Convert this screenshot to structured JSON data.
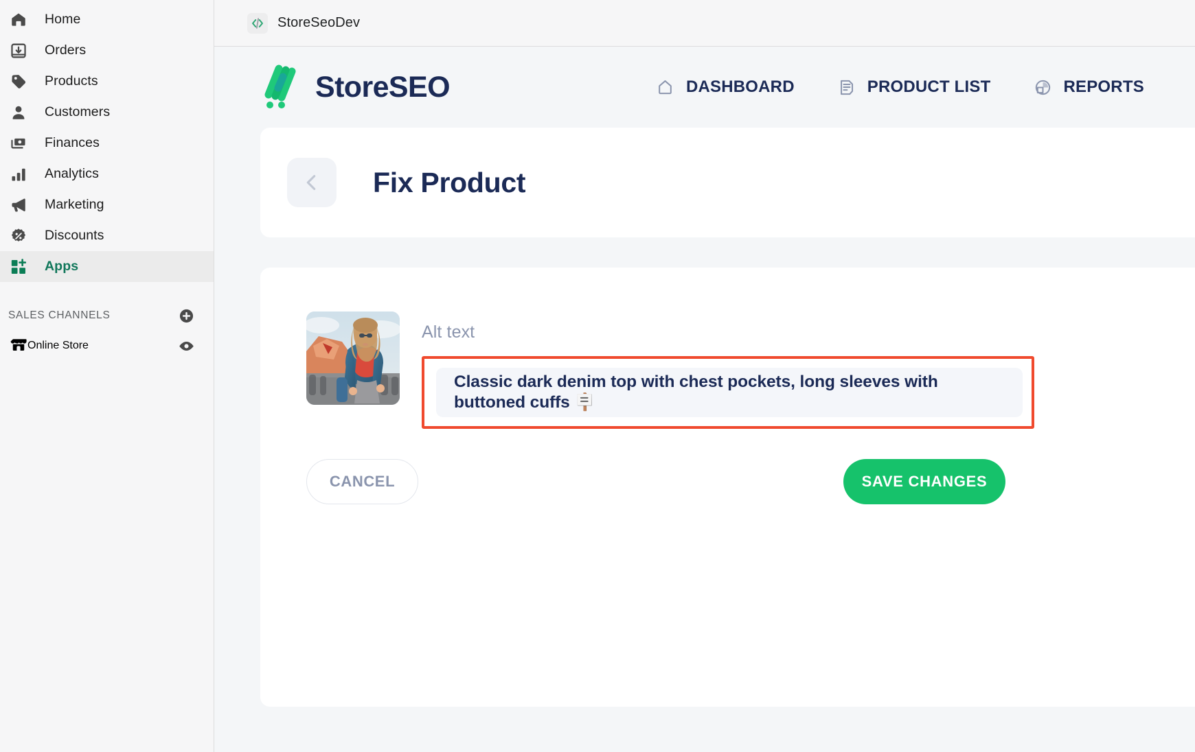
{
  "sidebar": {
    "items": [
      {
        "label": "Home",
        "icon": "home-icon",
        "active": false
      },
      {
        "label": "Orders",
        "icon": "orders-inbox-icon",
        "active": false
      },
      {
        "label": "Products",
        "icon": "product-tag-icon",
        "active": false
      },
      {
        "label": "Customers",
        "icon": "customer-person-icon",
        "active": false
      },
      {
        "label": "Finances",
        "icon": "finances-cash-icon",
        "active": false
      },
      {
        "label": "Analytics",
        "icon": "analytics-bars-icon",
        "active": false
      },
      {
        "label": "Marketing",
        "icon": "marketing-megaphone-icon",
        "active": false
      },
      {
        "label": "Discounts",
        "icon": "discount-percent-icon",
        "active": false
      },
      {
        "label": "Apps",
        "icon": "apps-grid-plus-icon",
        "active": true
      }
    ],
    "section": {
      "title": "SALES CHANNELS",
      "add_icon": "plus-circle-icon"
    },
    "store": {
      "label": "Online Store",
      "icon": "storefront-icon",
      "preview_icon": "eye-icon"
    }
  },
  "breadcrumb": {
    "icon": "code-brackets-icon",
    "label": "StoreSeoDev"
  },
  "app": {
    "logo_text": "StoreSEO",
    "logo_icon": "storeseo-logo-mark",
    "nav": [
      {
        "label": "DASHBOARD",
        "icon": "home-outline-icon"
      },
      {
        "label": "PRODUCT LIST",
        "icon": "document-list-icon"
      },
      {
        "label": "REPORTS",
        "icon": "pie-chart-icon"
      }
    ]
  },
  "page": {
    "back_icon": "chevron-left-icon",
    "title": "Fix Product"
  },
  "form": {
    "alt_text_label": "Alt text",
    "alt_text_value": "Classic dark denim top with chest pockets, long sleeves with buttoned cuffs 🪧",
    "alt_text_placeholder": "Alt text",
    "cancel_label": "CANCEL",
    "save_label": "SAVE CHANGES",
    "thumbnail_alt": "Woman in dark denim jacket and red top on a city street"
  },
  "colors": {
    "brand_navy": "#1b2a56",
    "brand_green": "#16c26b",
    "sidebar_active_green": "#10775a",
    "highlight_red": "#f04a2e",
    "muted_text": "#8a94ad",
    "field_bg": "#f4f6fa"
  }
}
